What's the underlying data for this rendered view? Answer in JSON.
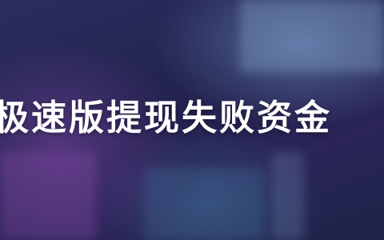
{
  "banner": {
    "headline": "极速版提现失败资金"
  }
}
